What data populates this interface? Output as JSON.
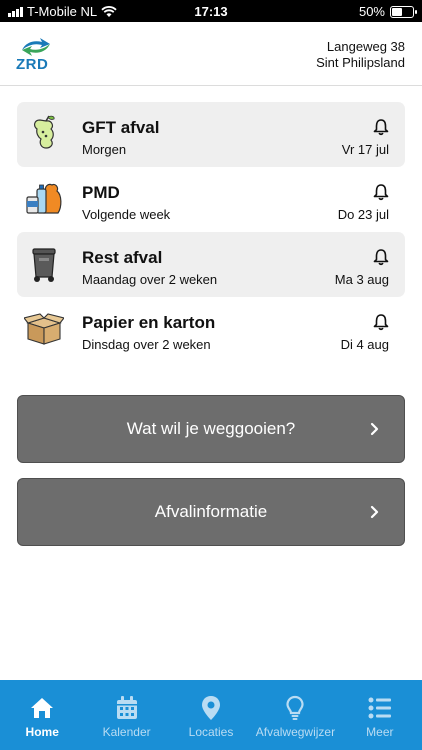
{
  "status_bar": {
    "carrier": "T-Mobile NL",
    "time": "17:13",
    "battery_text": "50%",
    "battery_level": 0.5
  },
  "header": {
    "logo_text": "ZRD",
    "address_street": "Langeweg 38",
    "address_city": "Sint Philipsland"
  },
  "pickups": [
    {
      "icon": "apple-core-icon",
      "title": "GFT afval",
      "subtitle": "Morgen",
      "date": "Vr 17 jul",
      "shaded": true
    },
    {
      "icon": "pmd-bag-icon",
      "title": "PMD",
      "subtitle": "Volgende week",
      "date": "Do 23 jul",
      "shaded": false
    },
    {
      "icon": "trash-bin-icon",
      "title": "Rest afval",
      "subtitle": "Maandag over 2 weken",
      "date": "Ma 3 aug",
      "shaded": true
    },
    {
      "icon": "cardboard-box-icon",
      "title": "Papier en karton",
      "subtitle": "Dinsdag over 2 weken",
      "date": "Di 4 aug",
      "shaded": false
    }
  ],
  "buttons": {
    "wegg_label": "Wat wil je weggooien?",
    "info_label": "Afvalinformatie"
  },
  "nav": [
    {
      "label": "Home",
      "icon": "home-icon",
      "active": true
    },
    {
      "label": "Kalender",
      "icon": "calendar-icon",
      "active": false
    },
    {
      "label": "Locaties",
      "icon": "location-pin-icon",
      "active": false
    },
    {
      "label": "Afvalwegwijzer",
      "icon": "lightbulb-icon",
      "active": false
    },
    {
      "label": "Meer",
      "icon": "list-icon",
      "active": false
    }
  ],
  "colors": {
    "nav_background": "#1a8fd6",
    "button_background": "#6d6d6d",
    "card_shade": "#efefef",
    "logo_blue": "#1a7ab8",
    "logo_green": "#3aa55a"
  }
}
